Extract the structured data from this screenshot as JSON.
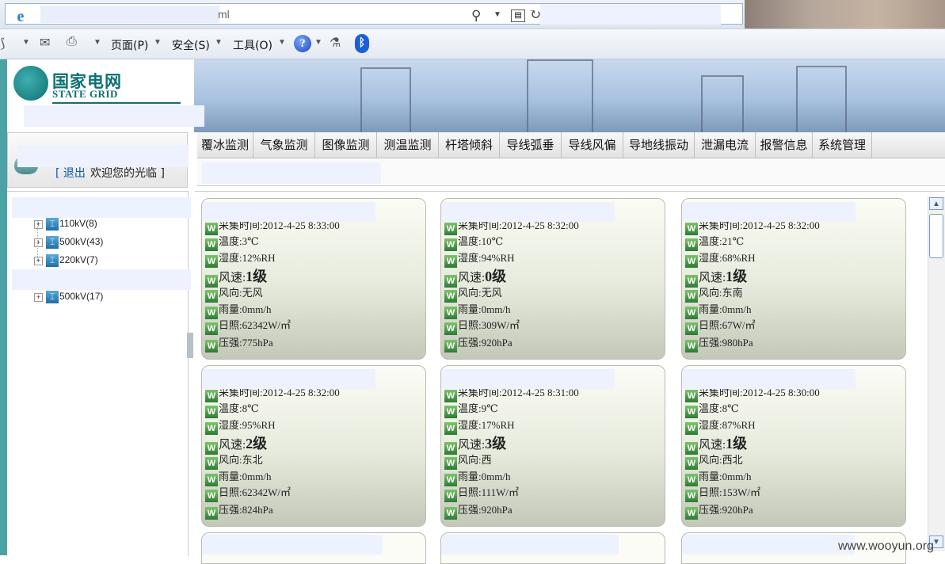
{
  "browser": {
    "url_suffix": "ml",
    "menu": [
      "页面(P)",
      "安全(S)",
      "工具(O)"
    ]
  },
  "banner": {
    "logo_cn": "国家电网",
    "logo_en": "STATE GRID"
  },
  "nav_tabs": [
    "覆冰监测",
    "气象监测",
    "图像监测",
    "测温监测",
    "杆塔倾斜",
    "导线弧垂",
    "导线风偏",
    "导地线振动",
    "泄漏电流",
    "报警信息",
    "系统管理"
  ],
  "user": {
    "logout": "[ 退出",
    "welcome": "欢迎您的光临 ]"
  },
  "tree": {
    "nodes": [
      "110kV(8)",
      "500kV(43)",
      "220kV(7)",
      "500kV(17)"
    ]
  },
  "cards": [
    {
      "time": "采集时间:2012-4-25 8:33:00",
      "temp": "温度:3℃",
      "humidity": "湿度:12%RH",
      "wind_label": "风速:",
      "wind_value": "1级",
      "direction": "风向:无风",
      "rain": "雨量:0mm/h",
      "sun": "日照:62342W/㎡",
      "pressure": "压强:775hPa"
    },
    {
      "time": "采集时间:2012-4-25 8:32:00",
      "temp": "温度:10℃",
      "humidity": "湿度:94%RH",
      "wind_label": "风速:",
      "wind_value": "0级",
      "direction": "风向:无风",
      "rain": "雨量:0mm/h",
      "sun": "日照:309W/㎡",
      "pressure": "压强:920hPa"
    },
    {
      "time": "采集时间:2012-4-25 8:32:00",
      "temp": "温度:21℃",
      "humidity": "湿度:68%RH",
      "wind_label": "风速:",
      "wind_value": "1级",
      "direction": "风向:东南",
      "rain": "雨量:0mm/h",
      "sun": "日照:67W/㎡",
      "pressure": "压强:980hPa"
    },
    {
      "time": "采集时间:2012-4-25 8:32:00",
      "temp": "温度:8℃",
      "humidity": "湿度:95%RH",
      "wind_label": "风速:",
      "wind_value": "2级",
      "direction": "风向:东北",
      "rain": "雨量:0mm/h",
      "sun": "日照:62342W/㎡",
      "pressure": "压强:824hPa"
    },
    {
      "time": "采集时间:2012-4-25 8:31:00",
      "temp": "温度:9℃",
      "humidity": "湿度:17%RH",
      "wind_label": "风速:",
      "wind_value": "3级",
      "direction": "风向:西",
      "rain": "雨量:0mm/h",
      "sun": "日照:111W/㎡",
      "pressure": "压强:920hPa"
    },
    {
      "time": "采集时间:2012-4-25 8:30:00",
      "temp": "温度:8℃",
      "humidity": "湿度:87%RH",
      "wind_label": "风速:",
      "wind_value": "1级",
      "direction": "风向:西北",
      "rain": "雨量:0mm/h",
      "sun": "日照:153W/㎡",
      "pressure": "压强:920hPa"
    }
  ],
  "watermark": "www.wooyun.org"
}
